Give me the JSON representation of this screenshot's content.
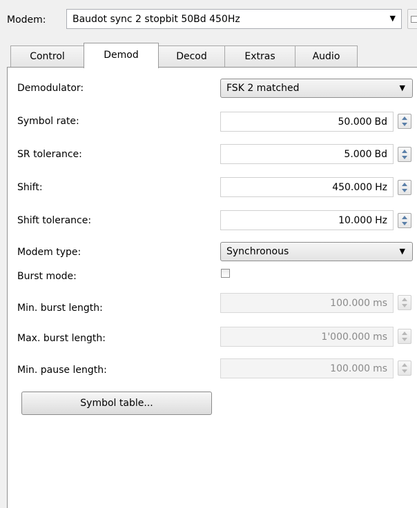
{
  "modem": {
    "label": "Modem:",
    "value": "Baudot sync 2 stopbit 50Bd 450Hz",
    "arrow": "▼"
  },
  "tabs": [
    {
      "label": "Control",
      "active": false
    },
    {
      "label": "Demod",
      "active": true
    },
    {
      "label": "Decod",
      "active": false
    },
    {
      "label": "Extras",
      "active": false
    },
    {
      "label": "Audio",
      "active": false
    }
  ],
  "demod": {
    "demodulator": {
      "label": "Demodulator:",
      "value": "FSK 2 matched"
    },
    "symbol_rate": {
      "label": "Symbol rate:",
      "value": "50.000",
      "unit": "Bd"
    },
    "sr_tolerance": {
      "label": "SR tolerance:",
      "value": "5.000",
      "unit": "Bd"
    },
    "shift": {
      "label": "Shift:",
      "value": "450.000",
      "unit": "Hz"
    },
    "shift_tolerance": {
      "label": "Shift tolerance:",
      "value": "10.000",
      "unit": "Hz"
    },
    "modem_type": {
      "label": "Modem type:",
      "value": "Synchronous"
    },
    "burst_mode": {
      "label": "Burst mode:",
      "checked": false
    },
    "min_burst": {
      "label": "Min. burst length:",
      "value": "100.000",
      "unit": "ms"
    },
    "max_burst": {
      "label": "Max. burst length:",
      "value": "1'000.000",
      "unit": "ms"
    },
    "min_pause": {
      "label": "Min. pause length:",
      "value": "100.000",
      "unit": "ms"
    },
    "symbol_table_button": "Symbol table..."
  },
  "dropdown_arrow": "▼"
}
